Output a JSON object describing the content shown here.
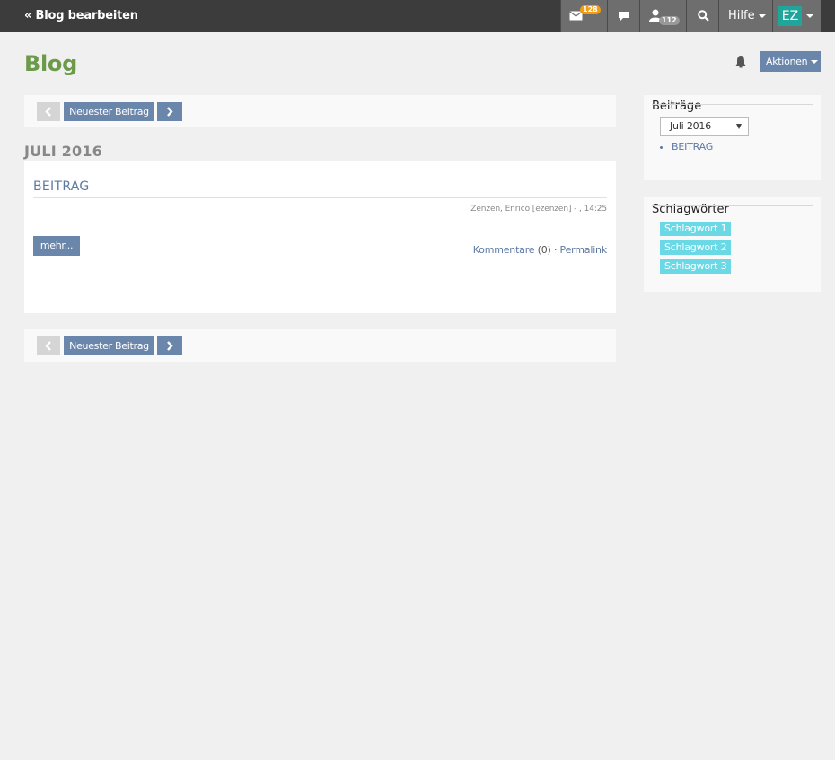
{
  "topbar": {
    "back_label": "« Blog bearbeiten",
    "mail_badge": "128",
    "users_badge": "112",
    "help_label": "Hilfe",
    "avatar_initials": "EZ"
  },
  "page": {
    "title": "Blog",
    "actions_label": "Aktionen"
  },
  "pager": {
    "newest_label": "Neuester Beitrag"
  },
  "month_heading": "JULI 2016",
  "post": {
    "title": "BEITRAG",
    "meta": "Zenzen, Enrico [ezenzen] - , 14:25",
    "more_label": "mehr...",
    "comments_label": "Kommentare",
    "comments_count": "(0)",
    "separator": "·",
    "permalink_label": "Permalink"
  },
  "sidebar": {
    "posts": {
      "heading": "Beiträge",
      "selected_month": "Juli 2016",
      "items": [
        "BEITRAG"
      ]
    },
    "tags": {
      "heading": "Schlagwörter",
      "items": [
        "Schlagwort 1",
        "Schlagwort 2",
        "Schlagwort 3"
      ]
    }
  },
  "colors": {
    "topbar": "#3c3c3c",
    "accent_blue": "#6a86ab",
    "title_green": "#6c9a4b",
    "mail_badge": "#f39c12",
    "avatar": "#1fa59a",
    "tag": "#6bd8e6"
  },
  "icons": [
    "envelope-icon",
    "chat-icon",
    "user-icon",
    "search-icon",
    "bell-icon",
    "chevron-left-icon",
    "chevron-right-icon"
  ]
}
